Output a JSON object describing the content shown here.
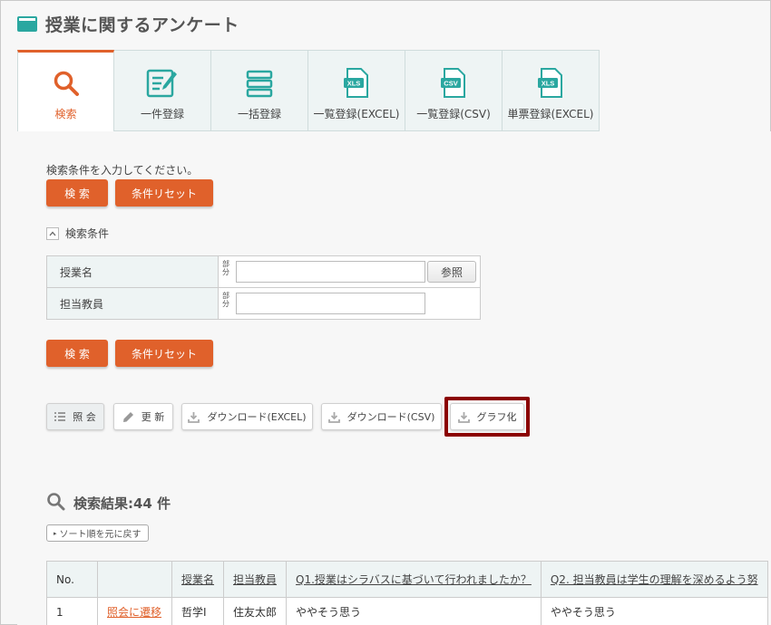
{
  "page": {
    "title": "授業に関するアンケート"
  },
  "tabs": [
    {
      "label": "検索",
      "icon": "search-icon",
      "active": true
    },
    {
      "label": "一件登録",
      "icon": "edit-form-icon"
    },
    {
      "label": "一括登録",
      "icon": "list-stack-icon"
    },
    {
      "label": "一覧登録(EXCEL)",
      "icon": "xls-file-icon",
      "badge": "XLS"
    },
    {
      "label": "一覧登録(CSV)",
      "icon": "csv-file-icon",
      "badge": "CSV"
    },
    {
      "label": "単票登録(EXCEL)",
      "icon": "xls-file-icon",
      "badge": "XLS"
    }
  ],
  "search": {
    "hint": "検索条件を入力してください。",
    "search_label": "検 索",
    "reset_label": "条件リセット",
    "conditions_toggle": "検索条件",
    "fields": [
      {
        "label": "授業名",
        "match": "部分",
        "value": "",
        "has_ref": true
      },
      {
        "label": "担当教員",
        "match": "部分",
        "value": "",
        "has_ref": false
      }
    ],
    "ref_label": "参照"
  },
  "actions": {
    "view": "照 会",
    "update": "更 新",
    "download_excel": "ダウンロード(EXCEL)",
    "download_csv": "ダウンロード(CSV)",
    "graph": "グラフ化"
  },
  "results": {
    "title": "検索結果:44 件",
    "sort_reset": "ソート順を元に戻す",
    "columns": [
      "No.",
      "",
      "授業名",
      "担当教員",
      "Q1.授業はシラバスに基づいて行われましたか？",
      "Q2. 担当教員は学生の理解を深めるよう努"
    ],
    "rows": [
      {
        "no": "1",
        "link": "照会に遷移",
        "course": "哲学Ⅰ",
        "teacher": "住友太郎",
        "q1": "ややそう思う",
        "q2": "ややそう思う"
      }
    ]
  },
  "colors": {
    "accent": "#e0612b",
    "teal": "#2aa7a0",
    "highlight": "#8b0000"
  }
}
